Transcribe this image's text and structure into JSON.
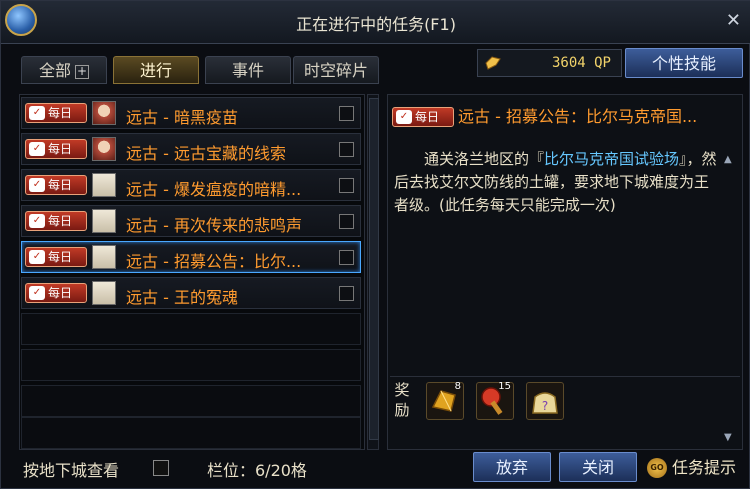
{
  "window": {
    "title": "正在进行中的任务(F1)",
    "close_label": "✕"
  },
  "tabs": [
    {
      "label": "全部",
      "has_plus": true,
      "plus_label": "+",
      "active": false
    },
    {
      "label": "进行",
      "active": true
    },
    {
      "label": "事件",
      "active": false
    },
    {
      "label": "时空碎片",
      "active": false
    }
  ],
  "qp": {
    "value": "3604 QP",
    "icon": "qp-coin-icon"
  },
  "personal_skill_button": "个性技能",
  "quests": [
    {
      "badge": "每日",
      "badge_mark": "✓",
      "avatar": "portrait-icon",
      "name": "远古 - 暗黑疫苗",
      "selected": false
    },
    {
      "badge": "每日",
      "badge_mark": "✓",
      "avatar": "portrait-icon",
      "name": "远古 - 远古宝藏的线索",
      "selected": false
    },
    {
      "badge": "每日",
      "badge_mark": "✓",
      "avatar": "scroll-icon",
      "name": "远古 - 爆发瘟疫的暗精...",
      "selected": false
    },
    {
      "badge": "每日",
      "badge_mark": "✓",
      "avatar": "scroll-icon",
      "name": "远古 - 再次传来的悲鸣声",
      "selected": false
    },
    {
      "badge": "每日",
      "badge_mark": "✓",
      "avatar": "scroll-icon",
      "name": "远古 - 招募公告：比尔...",
      "selected": true
    },
    {
      "badge": "每日",
      "badge_mark": "✓",
      "avatar": "scroll-icon",
      "name": "远古 - 王的冤魂",
      "selected": false
    }
  ],
  "detail": {
    "badge": "每日",
    "title": "远古 - 招募公告：比尔马克帝国...",
    "desc_pre": "　　通关洛兰地区的『",
    "desc_link": "比尔马克帝国试验场",
    "desc_post": "』，然后去找艾尔文防线的土罐，要求地下城难度为王者级。(此任务每天只能完成一次)"
  },
  "rewards": {
    "label": "奖励",
    "items": [
      {
        "icon": "gold-crystal-icon",
        "count": "8"
      },
      {
        "icon": "hammer-icon",
        "count": "15"
      },
      {
        "icon": "mystery-bag-icon",
        "count": ""
      }
    ]
  },
  "footer": {
    "dungeon_view_label": "按地下城查看",
    "slots_label": "栏位：6/20格",
    "abandon_button": "放弃",
    "close_button": "关闭",
    "quest_hint": "任务提示",
    "go_label": "GO"
  }
}
